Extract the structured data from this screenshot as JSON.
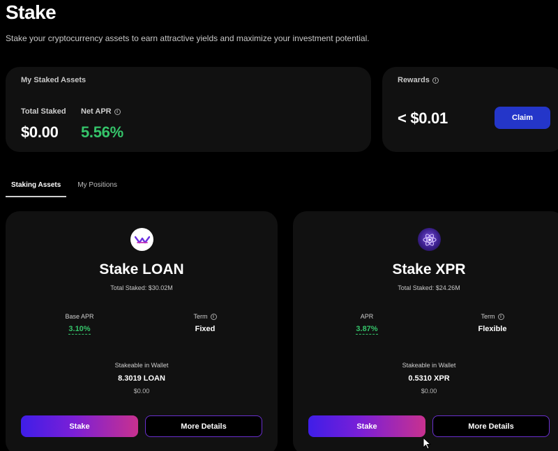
{
  "page": {
    "title": "Stake",
    "subtitle": "Stake your cryptocurrency assets to earn attractive yields and maximize your investment potential."
  },
  "my_staked_assets": {
    "heading": "My Staked Assets",
    "total_staked_label": "Total Staked",
    "total_staked_value": "$0.00",
    "net_apr_label": "Net APR",
    "net_apr_value": "5.56%"
  },
  "rewards": {
    "heading": "Rewards",
    "value": "< $0.01",
    "claim_label": "Claim"
  },
  "tabs": [
    {
      "label": "Staking Assets",
      "active": true
    },
    {
      "label": "My Positions",
      "active": false
    }
  ],
  "cards": [
    {
      "title": "Stake LOAN",
      "total_staked": "Total Staked: $30.02M",
      "apr_label": "Base APR",
      "apr_value": "3.10%",
      "term_label": "Term",
      "term_value": "Fixed",
      "wallet_label": "Stakeable in Wallet",
      "wallet_amount": "8.3019 LOAN",
      "wallet_usd": "$0.00",
      "stake_label": "Stake",
      "details_label": "More Details",
      "icon": "loan-logo-icon"
    },
    {
      "title": "Stake XPR",
      "total_staked": "Total Staked: $24.26M",
      "apr_label": "APR",
      "apr_value": "3.87%",
      "term_label": "Term",
      "term_value": "Flexible",
      "wallet_label": "Stakeable in Wallet",
      "wallet_amount": "0.5310 XPR",
      "wallet_usd": "$0.00",
      "stake_label": "Stake",
      "details_label": "More Details",
      "icon": "xpr-logo-icon"
    }
  ],
  "colors": {
    "background": "#000000",
    "panel": "#111111",
    "accent_green": "#35c46a",
    "claim_blue": "#2436c9",
    "gradient_start": "#3f1ee8",
    "gradient_end": "#c8318f"
  }
}
